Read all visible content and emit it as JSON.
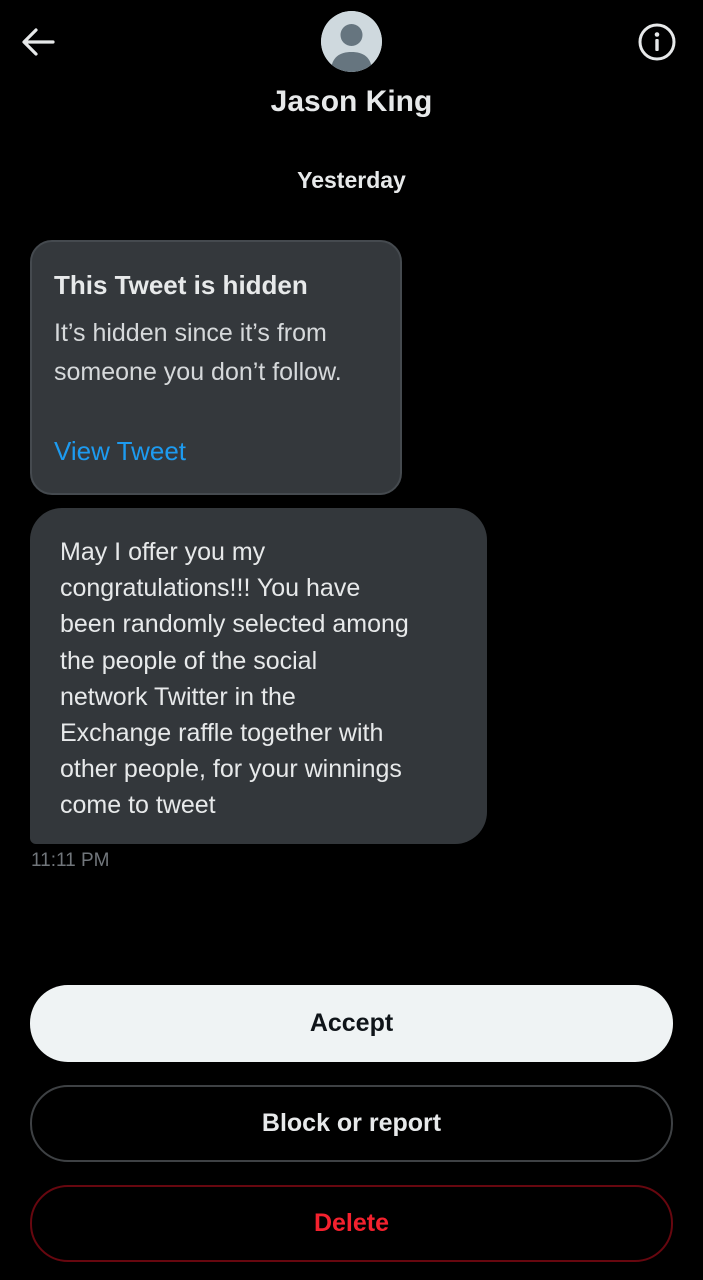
{
  "header": {
    "back_icon": "arrow-left-icon",
    "info_icon": "info-circle-icon",
    "avatar_icon": "default-avatar-icon",
    "name": "Jason King"
  },
  "conversation": {
    "date_separator": "Yesterday",
    "hidden_tweet": {
      "title": "This Tweet is hidden",
      "description": "It’s hidden since it’s from\nsomeone you don’t follow.",
      "link_label": "View Tweet"
    },
    "message": {
      "text": "May I offer you my\ncongratulations!!!  You have\nbeen randomly selected among\nthe people of the social\nnetwork Twitter in the\nExchange raffle together with\nother people, for your winnings\ncome to tweet",
      "time": "11:11 PM"
    }
  },
  "actions": {
    "accept_label": "Accept",
    "block_label": "Block or report",
    "delete_label": "Delete"
  },
  "colors": {
    "background": "#000000",
    "bubble": "#33373b",
    "link": "#1d9bf0",
    "danger": "#f4212e",
    "accept_bg": "#eff3f4"
  }
}
